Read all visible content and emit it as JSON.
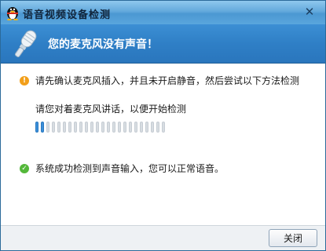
{
  "window": {
    "title": "语音视频设备检测",
    "close_glyph": "✕"
  },
  "banner": {
    "title": "您的麦克风没有声音！"
  },
  "content": {
    "instruction": "请先确认麦克风插入，并且未开启静音，然后尝试以下方法检测",
    "speak_prompt": "请您对着麦克风讲话，以便开始检测",
    "meter": {
      "segments": 24,
      "level": 2
    },
    "success_message": "系统成功检测到声音输入，您可以正常语音。"
  },
  "footer": {
    "close_label": "关闭"
  },
  "colors": {
    "title_bar": "#63a9dc",
    "banner": "#2f7fc6",
    "meter_on": "#3b8fd9",
    "meter_off": "#d8dde2",
    "info": "#f29f1a",
    "success": "#54b83a"
  },
  "icons": [
    "qq-penguin-icon",
    "close-icon",
    "microphone-icon",
    "info-icon",
    "check-icon"
  ]
}
